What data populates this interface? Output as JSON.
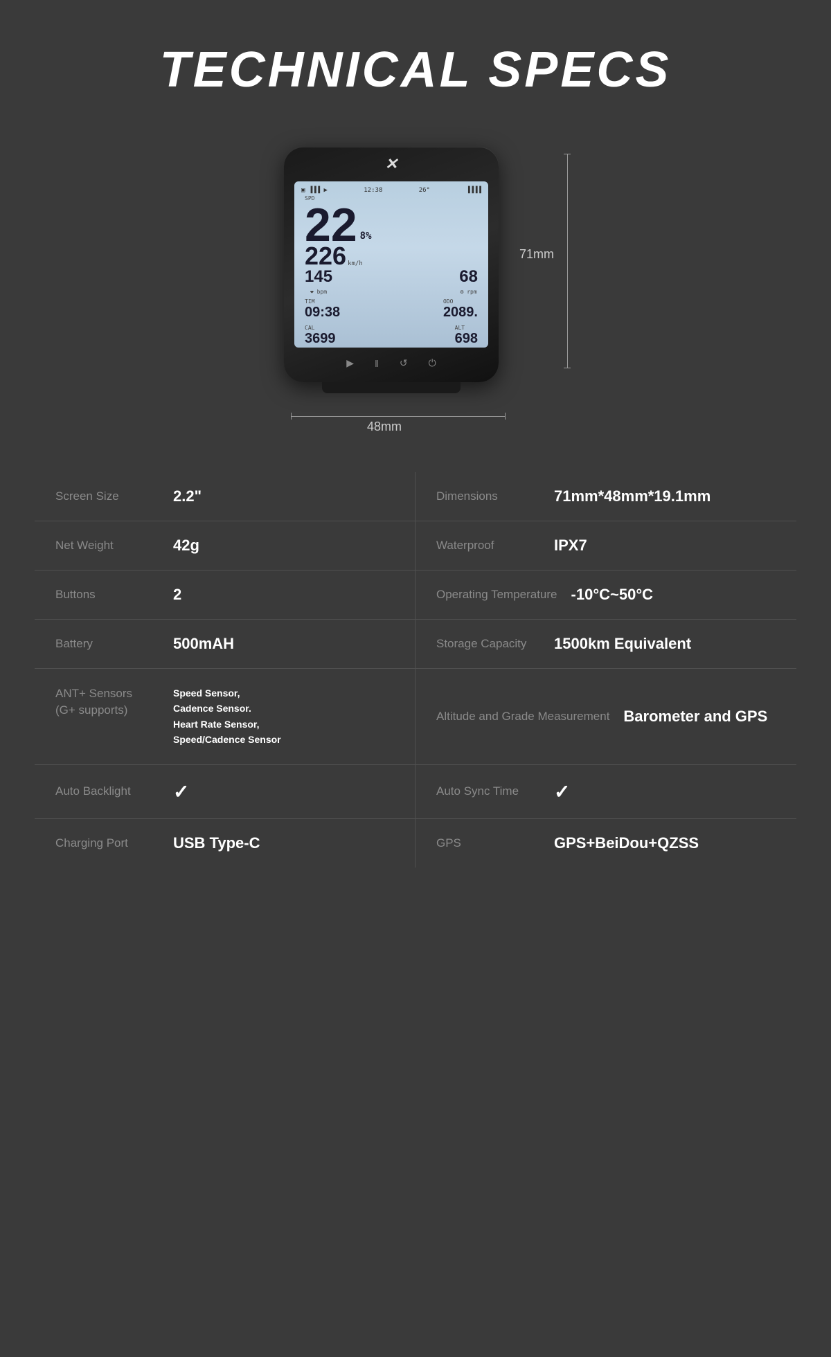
{
  "page": {
    "title": "TECHNICAL SPECS",
    "bg_color": "#3a3a3a"
  },
  "device": {
    "logo": "✕",
    "dimensions": {
      "width": "48mm",
      "height": "71mm"
    },
    "screen": {
      "time": "12:38",
      "temp": "26°",
      "spd_label": "SPD",
      "main_value": "22",
      "grade": "8%",
      "speed": "226",
      "kmh": "km/h",
      "heart_rate": "145",
      "heart_unit": "bpm",
      "cadence": "68",
      "cadence_unit": "rpm",
      "tim_label": "TIM",
      "tim_value": "09:38",
      "odo_label": "ODO",
      "odo_value": "2089.",
      "cal_label": "CAL",
      "cal_value": "3699",
      "alt_label": "ALT",
      "alt_value": "698"
    }
  },
  "specs": {
    "rows": [
      {
        "left_label": "Screen Size",
        "left_value": "2.2\"",
        "right_label": "Dimensions",
        "right_value": "71mm*48mm*19.1mm"
      },
      {
        "left_label": "Net Weight",
        "left_value": "42g",
        "right_label": "Waterproof",
        "right_value": "IPX7"
      },
      {
        "left_label": "Buttons",
        "left_value": "2",
        "right_label": "Operating Temperature",
        "right_value": "-10°C~50°C"
      },
      {
        "left_label": "Battery",
        "left_value": "500mAH",
        "right_label": "Storage Capacity",
        "right_value": "1500km Equivalent"
      },
      {
        "left_label": "ANT+ Sensors\n(G+ supports)",
        "left_value": "Speed Sensor,\nCadence Sensor.\nHeart Rate Sensor,\nSpeed/Cadence Sensor",
        "right_label": "Altitude and Grade Measurement",
        "right_value": "Barometer and GPS"
      },
      {
        "left_label": "Auto Backlight",
        "left_value": "✓",
        "left_checkmark": true,
        "right_label": "Auto Sync Time",
        "right_value": "✓",
        "right_checkmark": true
      },
      {
        "left_label": "Charging Port",
        "left_value": "USB Type-C",
        "right_label": "GPS",
        "right_value": "GPS+BeiDou+QZSS"
      }
    ]
  }
}
